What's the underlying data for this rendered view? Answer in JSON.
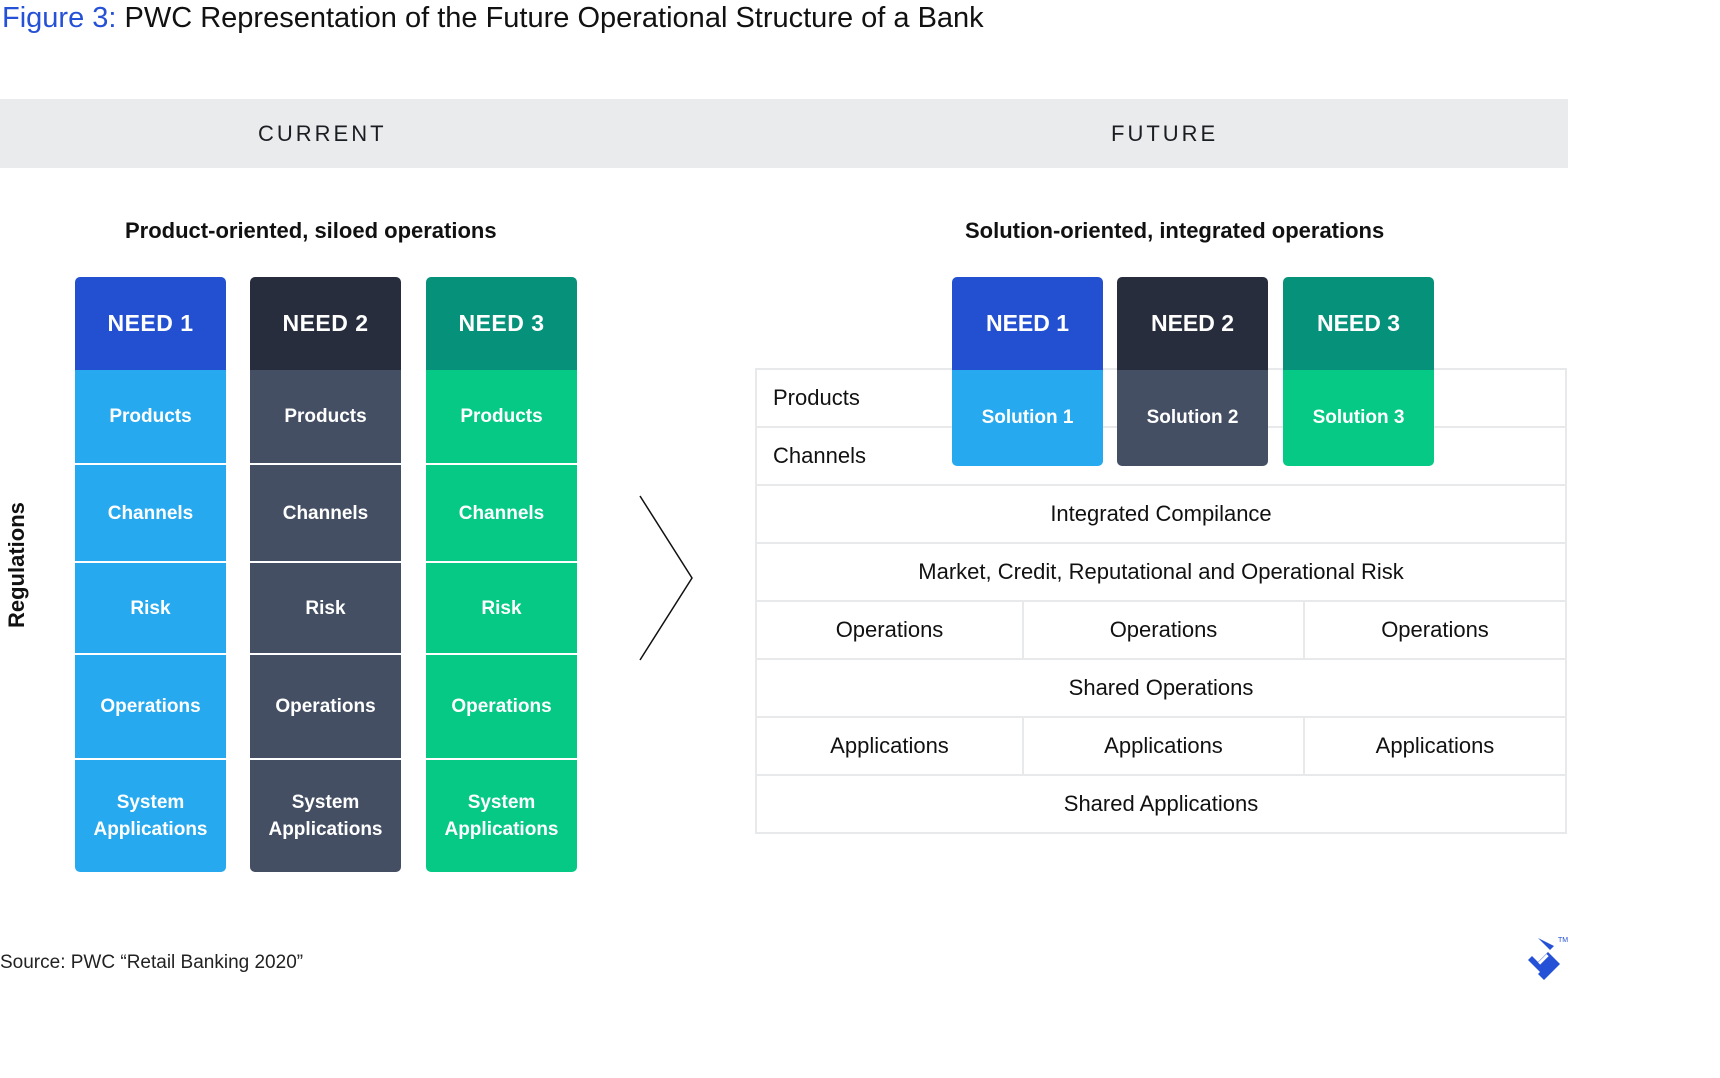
{
  "figure": {
    "label": "Figure 3:",
    "title": "PWC Representation of the Future Operational Structure of a Bank"
  },
  "band": {
    "current": "CURRENT",
    "future": "FUTURE"
  },
  "current": {
    "subtitle": "Product-oriented, siloed operations",
    "side_label": "Regulations",
    "columns": [
      {
        "need": "NEED 1",
        "header_color": "#2350d1",
        "cell_color": "#26a9ee",
        "cells": [
          "Products",
          "Channels",
          "Risk",
          "Operations",
          "System Applications"
        ]
      },
      {
        "need": "NEED 2",
        "header_color": "#272d3c",
        "cell_color": "#444f63",
        "cells": [
          "Products",
          "Channels",
          "Risk",
          "Operations",
          "System Applications"
        ]
      },
      {
        "need": "NEED 3",
        "header_color": "#06927a",
        "cell_color": "#05c985",
        "cells": [
          "Products",
          "Channels",
          "Risk",
          "Operations",
          "System Applications"
        ]
      }
    ]
  },
  "future": {
    "subtitle": "Solution-oriented, integrated operations",
    "needs": [
      {
        "need": "NEED 1",
        "solution": "Solution 1",
        "header_color": "#2350d1",
        "cell_color": "#26a9ee"
      },
      {
        "need": "NEED 2",
        "solution": "Solution 2",
        "header_color": "#272d3c",
        "cell_color": "#444f63"
      },
      {
        "need": "NEED 3",
        "solution": "Solution 3",
        "header_color": "#06927a",
        "cell_color": "#05c985"
      }
    ],
    "rows": [
      {
        "cells": [
          "Products"
        ],
        "type": "label"
      },
      {
        "cells": [
          "Channels"
        ],
        "type": "label"
      },
      {
        "cells": [
          "Integrated Compilance"
        ]
      },
      {
        "cells": [
          "Market, Credit, Reputational and Operational Risk"
        ]
      },
      {
        "cells": [
          "Operations",
          "Operations",
          "Operations"
        ]
      },
      {
        "cells": [
          "Shared Operations"
        ]
      },
      {
        "cells": [
          "Applications",
          "Applications",
          "Applications"
        ]
      },
      {
        "cells": [
          "Shared Applications"
        ]
      }
    ]
  },
  "source": "Source: PWC “Retail Banking 2020”",
  "logo": {
    "name": "toptal-logo",
    "mark": "TM",
    "color": "#2551d6"
  }
}
